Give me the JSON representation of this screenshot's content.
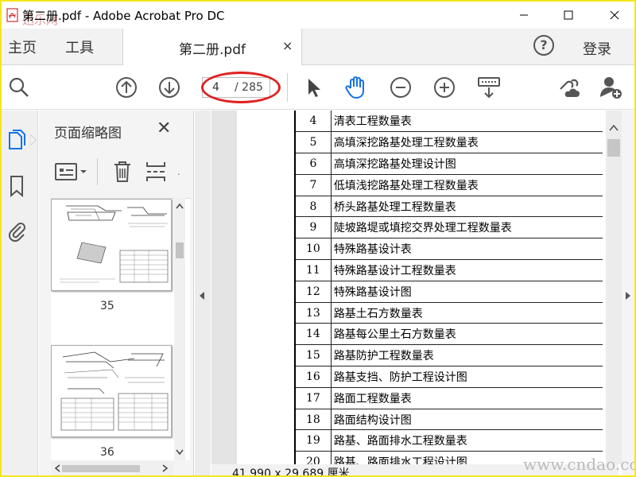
{
  "window": {
    "title": "第二册.pdf - Adobe Acrobat Pro DC",
    "minimize_label": "—",
    "maximize_label": "☐",
    "close_label": "✕",
    "corner_watermark": "迅乐网"
  },
  "menubar": {
    "home": "主页",
    "tools": "工具",
    "tab_label": "第二册.pdf",
    "tab_close": "×",
    "help": "?",
    "login": "登录"
  },
  "toolbar": {
    "current_page": "4",
    "total_pages": "/ 285",
    "icons": [
      "search-icon",
      "page-up-icon",
      "page-down-icon",
      "select-cursor-icon",
      "hand-tool-icon",
      "zoom-out-icon",
      "zoom-in-icon",
      "keyboard-scroll-icon",
      "link-cloud-icon",
      "add-user-icon"
    ]
  },
  "panel": {
    "title": "页面缩略图",
    "close": "✕",
    "thumbnails": [
      {
        "label": "35"
      },
      {
        "label": "36"
      }
    ]
  },
  "document": {
    "rows": [
      {
        "num": "4",
        "name": "清表工程数量表"
      },
      {
        "num": "5",
        "name": "高填深挖路基处理工程数量表"
      },
      {
        "num": "6",
        "name": "高填深挖路基处理设计图"
      },
      {
        "num": "7",
        "name": "低填浅挖路基处理工程数量表"
      },
      {
        "num": "8",
        "name": "桥头路基处理工程数量表"
      },
      {
        "num": "9",
        "name": "陡坡路堤或填挖交界处理工程数量表"
      },
      {
        "num": "10",
        "name": "特殊路基设计表"
      },
      {
        "num": "11",
        "name": "特殊路基设计工程数量表"
      },
      {
        "num": "12",
        "name": "特殊路基设计图"
      },
      {
        "num": "13",
        "name": "路基土石方数量表"
      },
      {
        "num": "14",
        "name": "路基每公里土石方数量表"
      },
      {
        "num": "15",
        "name": "路基防护工程数量表"
      },
      {
        "num": "16",
        "name": "路基支挡、防护工程设计图"
      },
      {
        "num": "17",
        "name": "路面工程数量表"
      },
      {
        "num": "18",
        "name": "路面结构设计图"
      },
      {
        "num": "19",
        "name": "路基、路面排水工程数量表"
      },
      {
        "num": "20",
        "name": "路基、路面排水工程设计图"
      }
    ]
  },
  "status": {
    "page_size": "41.990 x 29.689 厘米",
    "watermark": "www.cndao.com"
  },
  "colors": {
    "frame_border": "#f5e61a",
    "accent_blue": "#1473e6",
    "annotation_red": "#e02020"
  }
}
